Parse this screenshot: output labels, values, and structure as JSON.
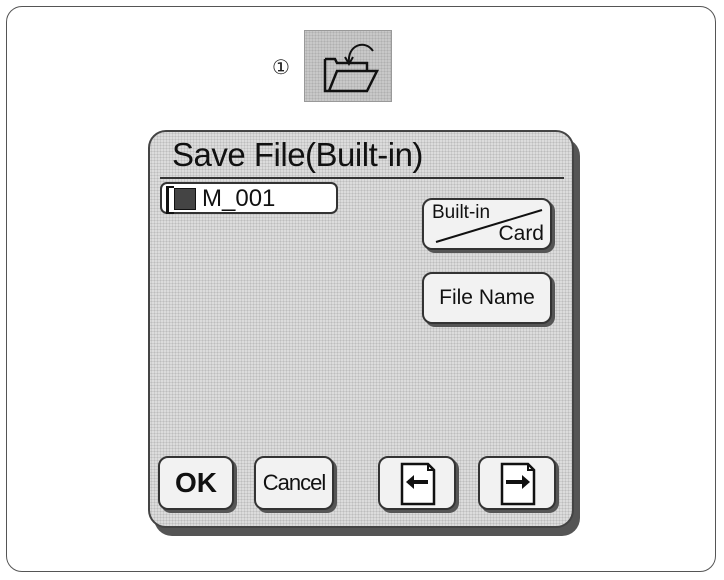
{
  "callout": {
    "number": "①"
  },
  "toolbar": {
    "open_icon": "folder-open-icon"
  },
  "dialog": {
    "title": "Save File(Built-in)",
    "file_item": {
      "name": "M_001",
      "icon": "embroidery-file-icon"
    },
    "builtin_card_button": {
      "top_label": "Built-in",
      "bottom_label": "Card"
    },
    "file_name_button": {
      "label": "File Name"
    },
    "ok_button": {
      "label": "OK"
    },
    "cancel_button": {
      "label": "Cancel"
    },
    "prev_page_icon": "left-arrow-page-icon",
    "next_page_icon": "right-arrow-page-icon"
  }
}
